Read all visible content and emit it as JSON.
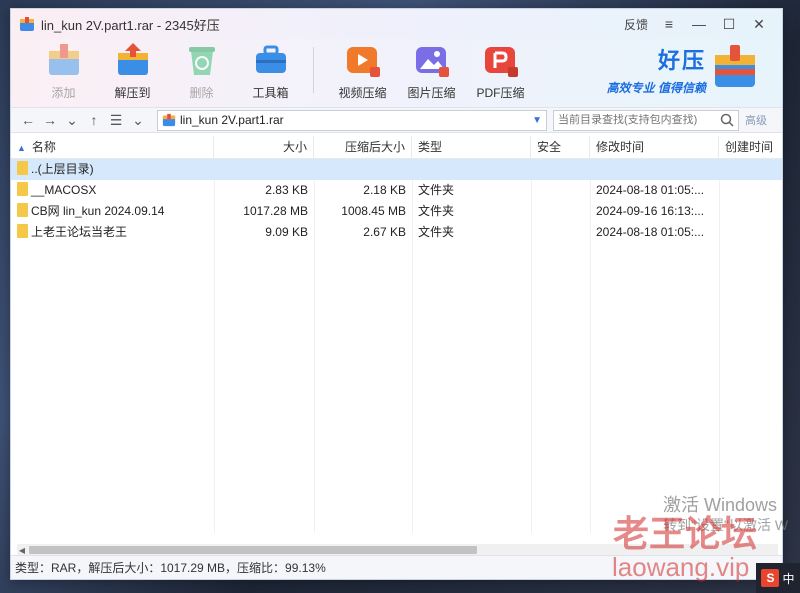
{
  "window": {
    "title": "lin_kun  2V.part1.rar - 2345好压",
    "feedback": "反馈",
    "menu_icon": "≡",
    "min_icon": "—",
    "max_icon": "☐",
    "close_icon": "✕"
  },
  "toolbar": {
    "buttons": [
      {
        "label": "添加",
        "icon": "add-archive-icon",
        "enabled": false
      },
      {
        "label": "解压到",
        "icon": "extract-icon",
        "enabled": true
      },
      {
        "label": "删除",
        "icon": "recycle-icon",
        "enabled": false
      },
      {
        "label": "工具箱",
        "icon": "toolbox-icon",
        "enabled": true
      },
      {
        "label": "视频压缩",
        "icon": "video-compress-icon",
        "enabled": true
      },
      {
        "label": "图片压缩",
        "icon": "image-compress-icon",
        "enabled": true
      },
      {
        "label": "PDF压缩",
        "icon": "pdf-compress-icon",
        "enabled": true
      }
    ]
  },
  "brand": {
    "name": "好压",
    "slogan": "高效专业  值得信赖",
    "color": "#1d6fe0"
  },
  "address": {
    "path": "lin_kun  2V.part1.rar",
    "search_placeholder": "当前目录查找(支持包内查找)",
    "advanced": "高级"
  },
  "table": {
    "headers": [
      "名称",
      "大小",
      "压缩后大小",
      "类型",
      "安全",
      "修改时间",
      "创建时间"
    ],
    "rows": [
      {
        "name": "..(上层目录)",
        "size": "",
        "packed": "",
        "type": "",
        "safety": "",
        "modified": "",
        "created": "",
        "selected": true
      },
      {
        "name": "__MACOSX",
        "size": "2.83 KB",
        "packed": "2.18 KB",
        "type": "文件夹",
        "safety": "",
        "modified": "2024-08-18 01:05:...",
        "created": ""
      },
      {
        "name": "CB网 lin_kun 2024.09.14",
        "size": "1017.28 MB",
        "packed": "1008.45 MB",
        "type": "文件夹",
        "safety": "",
        "modified": "2024-09-16 16:13:...",
        "created": ""
      },
      {
        "name": "上老王论坛当老王",
        "size": "9.09 KB",
        "packed": "2.67 KB",
        "type": "文件夹",
        "safety": "",
        "modified": "2024-08-18 01:05:...",
        "created": ""
      }
    ]
  },
  "status": {
    "text": "类型：RAR，解压后大小：1017.29 MB，压缩比：99.13%"
  },
  "overlay": {
    "activate_windows": "激活 Windows",
    "activate_sub": "转到\"设置\"以激活 W",
    "site_watermark": "老王论坛",
    "site_domain": "laowang.vip",
    "ime_label": "中"
  }
}
